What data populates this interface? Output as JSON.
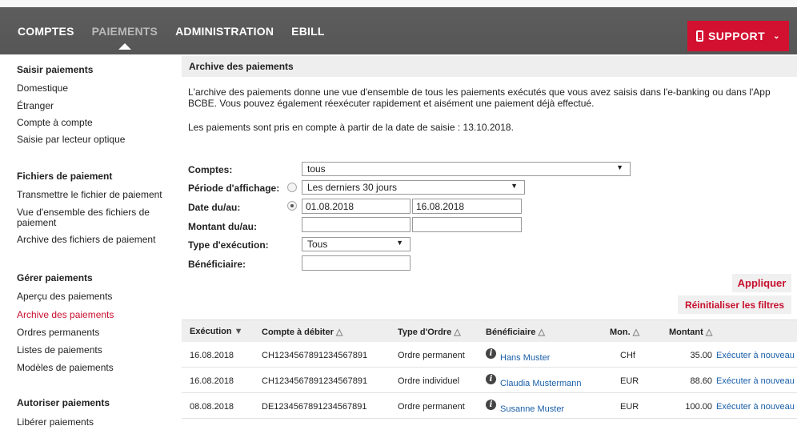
{
  "topnav": {
    "items": [
      {
        "label": "COMPTES"
      },
      {
        "label": "PAIEMENTS"
      },
      {
        "label": "ADMINISTRATION"
      },
      {
        "label": "EBILL"
      }
    ],
    "support_label": "SUPPORT"
  },
  "sidebar": {
    "sections": [
      {
        "title": "Saisir paiements",
        "items": [
          "Domestique",
          "Étranger",
          "Compte à compte",
          "Saisie par lecteur optique"
        ]
      },
      {
        "title": "Fichiers de paiement",
        "items": [
          "Transmettre le fichier de paiement",
          "Vue d'ensemble des fichiers de paiement",
          "Archive des fichiers de paiement"
        ]
      },
      {
        "title": "Gérer paiements",
        "items": [
          "Aperçu des paiements",
          "Archive des paiements",
          "Ordres permanents",
          "Listes de paiements",
          "Modèles de paiements"
        ]
      },
      {
        "title": "Autoriser paiements",
        "items": [
          "Libérer paiements"
        ]
      }
    ]
  },
  "main": {
    "title": "Archive des paiements",
    "intro": "L'archive des paiements donne une vue d'ensemble de tous les paiements exécutés que vous avez saisis dans l'e-banking ou dans l'App BCBE. Vous pouvez également réexécuter rapidement et aisément une paiement déjà effectué.",
    "intro2": "Les paiements sont pris en compte à partir de la date de saisie : 13.10.2018."
  },
  "filters": {
    "comptes_label": "Comptes:",
    "comptes_value": "tous",
    "periode_label": "Période d'affichage:",
    "periode_value": "Les derniers 30 jours",
    "date_label": "Date du/au:",
    "date_from": "01.08.2018",
    "date_to": "16.08.2018",
    "montant_label": "Montant du/au:",
    "montant_from": "",
    "montant_to": "",
    "type_label": "Type d'exécution:",
    "type_value": "Tous",
    "benef_label": "Bénéficiaire:",
    "benef_value": "",
    "apply_label": "Appliquer",
    "reset_label": "Réinitialiser les filtres"
  },
  "table": {
    "headers": {
      "execution": "Exécution",
      "compte": "Compte à débiter",
      "type": "Type d'Ordre",
      "benef": "Bénéficiaire",
      "mon": "Mon.",
      "montant": "Montant"
    },
    "rows": [
      {
        "execution": "16.08.2018",
        "compte": "CH1234567891234567891",
        "type": "Ordre permanent",
        "benef": "Hans Muster",
        "mon": "CHf",
        "montant": "35.00",
        "action": "Exécuter à nouveau"
      },
      {
        "execution": "16.08.2018",
        "compte": "CH1234567891234567891",
        "type": "Ordre individuel",
        "benef": "Claudia Mustermann",
        "mon": "EUR",
        "montant": "88.60",
        "action": "Exécuter à nouveau"
      },
      {
        "execution": "08.08.2018",
        "compte": "DE1234567891234567891",
        "type": "Ordre permanent",
        "benef": "Susanne Muster",
        "mon": "EUR",
        "montant": "100.00",
        "action": "Exécuter à nouveau"
      }
    ]
  },
  "colors": {
    "accent": "#c8102e",
    "support": "#d2102f",
    "link": "#1a5fa8",
    "topbar": "#5a5a5a"
  }
}
